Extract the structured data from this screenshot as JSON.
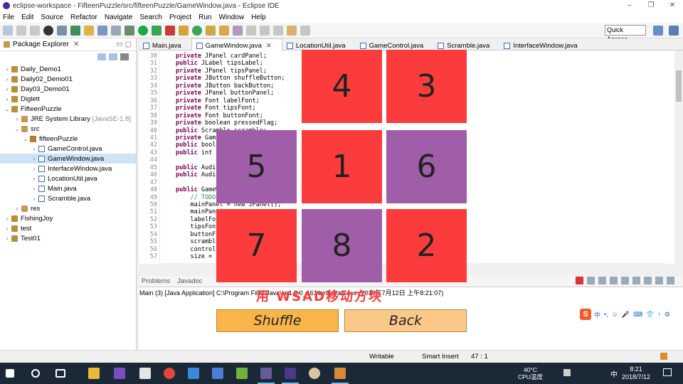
{
  "window": {
    "title": "eclipse-workspace - FifteenPuzzle/src/fifteenPuzzle/GameWindow.java - Eclipse IDE",
    "controls": [
      "–",
      "❐",
      "✕"
    ]
  },
  "menu": [
    "File",
    "Edit",
    "Source",
    "Refactor",
    "Navigate",
    "Search",
    "Project",
    "Run",
    "Window",
    "Help"
  ],
  "toolbar": {
    "quick_access": "Quick Access"
  },
  "package_explorer": {
    "title": "Package Explorer",
    "close": "✕",
    "items": [
      {
        "label": "Daily_Demo1",
        "arrow": "›"
      },
      {
        "label": "Daily02_Demo01",
        "arrow": "›"
      },
      {
        "label": "Day03_Demo01",
        "arrow": "›"
      },
      {
        "label": "Diglett",
        "arrow": "›"
      },
      {
        "label": "FifteenPuzzle",
        "arrow": "⌄"
      },
      {
        "label": "JRE System Library",
        "suffix": "[JavaSE-1.8]",
        "arrow": "›"
      },
      {
        "label": "src",
        "arrow": "⌄"
      },
      {
        "label": "fifteenPuzzle",
        "arrow": "⌄"
      },
      {
        "label": "GameControl.java",
        "arrow": "›"
      },
      {
        "label": "GameWindow.java",
        "arrow": "›"
      },
      {
        "label": "InterfaceWindow.java",
        "arrow": "›"
      },
      {
        "label": "LocationUtil.java",
        "arrow": "›"
      },
      {
        "label": "Main.java",
        "arrow": "›"
      },
      {
        "label": "Scramble.java",
        "arrow": "›"
      },
      {
        "label": "res",
        "arrow": "›"
      },
      {
        "label": "FishingJoy",
        "arrow": "›"
      },
      {
        "label": "test",
        "arrow": "›"
      },
      {
        "label": "Test01",
        "arrow": "›"
      }
    ]
  },
  "editor_tabs": [
    {
      "label": "Main.java"
    },
    {
      "label": "GameWindow.java",
      "close": "✕"
    },
    {
      "label": "LocationUtil.java"
    },
    {
      "label": "GameControl.java"
    },
    {
      "label": "Scramble.java"
    },
    {
      "label": "InterfaceWindow.java"
    }
  ],
  "code_lines": [
    {
      "n": "30",
      "kw": "private",
      "rest": " JPanel cardPanel;"
    },
    {
      "n": "31",
      "kw": "public",
      "rest": " JLabel tipsLabel;"
    },
    {
      "n": "32",
      "kw": "private",
      "rest": " JPanel tipsPanel;"
    },
    {
      "n": "33",
      "kw": "private",
      "rest": " JButton shuffleButton;"
    },
    {
      "n": "34",
      "kw": "private",
      "rest": " JButton backButton;"
    },
    {
      "n": "35",
      "kw": "private",
      "rest": " JPanel buttonPanel;"
    },
    {
      "n": "36",
      "kw": "private",
      "rest": " Font labelFont;"
    },
    {
      "n": "37",
      "kw": "private",
      "rest": " Font tipsFont;"
    },
    {
      "n": "38",
      "kw": "private",
      "rest": " Font buttonFont;"
    },
    {
      "n": "39",
      "kw": "private",
      "rest": " boolean pressedFlag;"
    },
    {
      "n": "40",
      "kw": "public",
      "rest": " Scramble scramble;"
    },
    {
      "n": "41",
      "kw": "private",
      "rest": " Game"
    },
    {
      "n": "42",
      "kw": "public",
      "rest": " boole"
    },
    {
      "n": "43",
      "kw": "public",
      "rest": " int s"
    },
    {
      "n": "44",
      "kw": "",
      "rest": ""
    },
    {
      "n": "45",
      "kw": "public",
      "rest": " Audio"
    },
    {
      "n": "46",
      "kw": "public",
      "rest": " Audio"
    },
    {
      "n": "47",
      "kw": "",
      "rest": ""
    },
    {
      "n": "48",
      "kw": "public",
      "rest": " GameW"
    },
    {
      "n": "49",
      "kw": "",
      "rest": "    // TODO"
    },
    {
      "n": "50",
      "kw": "",
      "rest": "    mainPanel = new JPanel();"
    },
    {
      "n": "51",
      "kw": "",
      "rest": "    mainPane"
    },
    {
      "n": "52",
      "kw": "",
      "rest": "    labelFon"
    },
    {
      "n": "53",
      "kw": "",
      "rest": "    tipsFont"
    },
    {
      "n": "54",
      "kw": "",
      "rest": "    buttonFo"
    },
    {
      "n": "55",
      "kw": "",
      "rest": "    scramble"
    },
    {
      "n": "56",
      "kw": "",
      "rest": "    control"
    },
    {
      "n": "57",
      "kw": "",
      "rest": "    size = n"
    }
  ],
  "console": {
    "tabs": [
      "Problems",
      "Javadoc"
    ],
    "text": "Main (3) [Java Application] C:\\Program Files\\Java\\jre1.8.0_161\\bin\\javaw.exe (2018年7月12日 上午8:21:07)"
  },
  "status": {
    "mode": "Writable",
    "insert": "Smart Insert",
    "position": "47 : 1"
  },
  "game": {
    "tiles": [
      {
        "value": "",
        "color": "none"
      },
      {
        "value": "4",
        "color": "red"
      },
      {
        "value": "3",
        "color": "red"
      },
      {
        "value": "5",
        "color": "purple"
      },
      {
        "value": "1",
        "color": "red"
      },
      {
        "value": "6",
        "color": "purple"
      },
      {
        "value": "7",
        "color": "red"
      },
      {
        "value": "8",
        "color": "purple"
      },
      {
        "value": "2",
        "color": "red"
      }
    ],
    "tips": "用 WSAD移动方块",
    "shuffle_label": "Shuffle",
    "back_label": "Back",
    "colors": {
      "red": "#fc3c3c",
      "purple": "#a05ea8",
      "shuffle": "#f9b44a",
      "back": "#fbc88a"
    }
  },
  "ime": {
    "logo": "S",
    "lang": "中",
    "punct": "•,",
    "tools": [
      "☺",
      "🎤",
      "⌨",
      "👕",
      "↑",
      "⚙"
    ]
  },
  "taskbar": {
    "temp": "40°C",
    "temp_label": "CPU温度",
    "ime_lang": "中",
    "time": "8:21",
    "date": "2018/7/12"
  }
}
